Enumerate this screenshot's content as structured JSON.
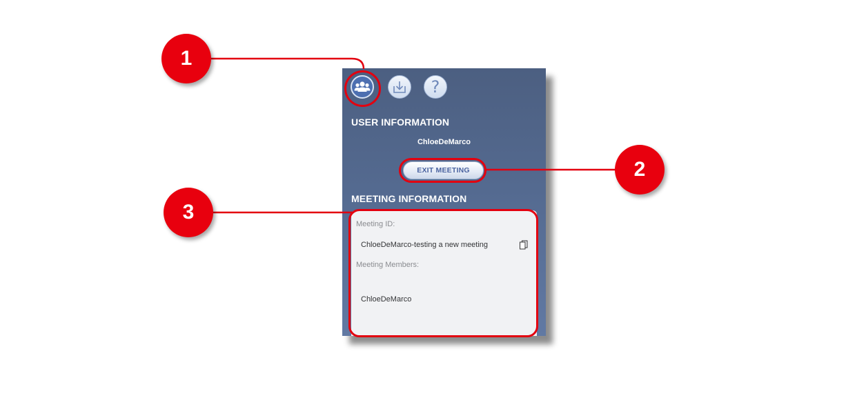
{
  "toolbar": {
    "icons": [
      "users-icon",
      "download-icon",
      "help-icon"
    ]
  },
  "user_info": {
    "title": "USER INFORMATION",
    "username": "ChloeDeMarco",
    "exit_button": "EXIT MEETING"
  },
  "meeting_info": {
    "title": "MEETING INFORMATION",
    "id_label": "Meeting ID:",
    "id_value": "ChloeDeMarco-testing a new meeting",
    "members_label": "Meeting Members:",
    "members": [
      "ChloeDeMarco"
    ]
  },
  "callouts": [
    "1",
    "2",
    "3"
  ],
  "colors": {
    "panel": "#546a90",
    "annotation_red": "#e3000f",
    "card": "#f1f2f4"
  }
}
